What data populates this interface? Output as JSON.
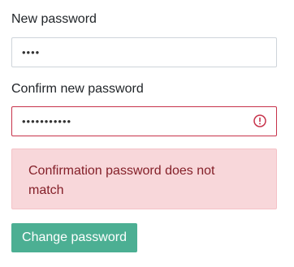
{
  "form": {
    "new_password": {
      "label": "New password",
      "value_display": "••••"
    },
    "confirm_password": {
      "label": "Confirm new password",
      "value_display": "•••••••••••",
      "error_icon": "exclamation-circle-icon"
    },
    "alert": {
      "message": "Confirmation password does not match"
    },
    "submit_label": "Change password"
  },
  "colors": {
    "error_border": "#c7324a",
    "alert_background": "#f8d7da",
    "alert_text": "#842029",
    "button_background": "#4caf93",
    "button_text": "#ffffff"
  }
}
